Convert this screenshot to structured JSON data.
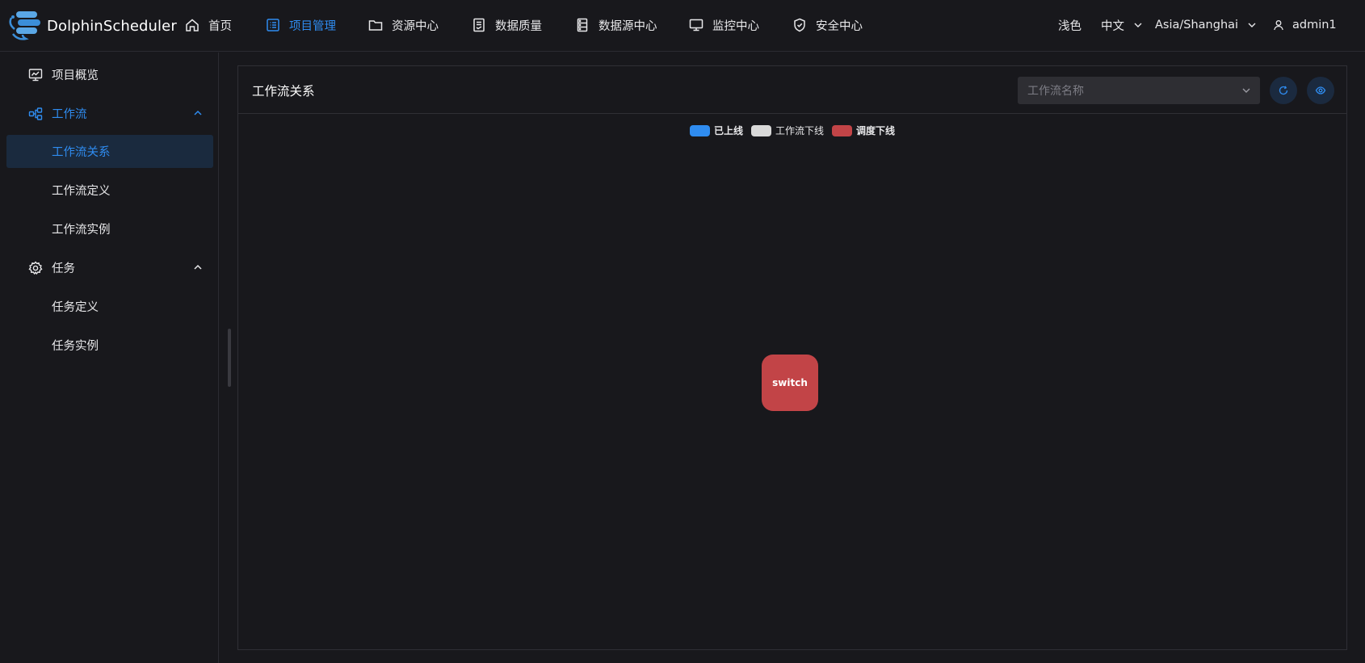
{
  "brand": {
    "name": "DolphinScheduler"
  },
  "nav": [
    {
      "label": "首页",
      "icon": "home-icon"
    },
    {
      "label": "项目管理",
      "icon": "project-icon",
      "active": true
    },
    {
      "label": "资源中心",
      "icon": "folder-icon"
    },
    {
      "label": "数据质量",
      "icon": "document-icon"
    },
    {
      "label": "数据源中心",
      "icon": "database-icon"
    },
    {
      "label": "监控中心",
      "icon": "monitor-icon"
    },
    {
      "label": "安全中心",
      "icon": "shield-icon"
    }
  ],
  "header_right": {
    "theme": "浅色",
    "language": "中文",
    "timezone": "Asia/Shanghai",
    "user": "admin1"
  },
  "sidebar": {
    "items": [
      {
        "label": "项目概览",
        "icon": "overview-icon"
      },
      {
        "label": "工作流",
        "icon": "workflow-icon",
        "expanded": true
      },
      {
        "label": "工作流关系",
        "selected": true
      },
      {
        "label": "工作流定义"
      },
      {
        "label": "工作流实例"
      },
      {
        "label": "任务",
        "icon": "gear-icon",
        "expanded": true
      },
      {
        "label": "任务定义"
      },
      {
        "label": "任务实例"
      }
    ]
  },
  "main": {
    "title": "工作流关系",
    "select_placeholder": "工作流名称",
    "legend": [
      {
        "label": "已上线",
        "color": "#2f8cf0"
      },
      {
        "label": "工作流下线",
        "color": "#d9d9d9"
      },
      {
        "label": "调度下线",
        "color": "#c24447"
      }
    ],
    "graph": {
      "nodes": [
        {
          "label": "switch",
          "status": "调度下线",
          "color": "#c24447"
        }
      ]
    }
  },
  "colors": {
    "accent": "#2f8cf0",
    "background": "#18181c",
    "selected_bg": "#1a2a3e"
  }
}
